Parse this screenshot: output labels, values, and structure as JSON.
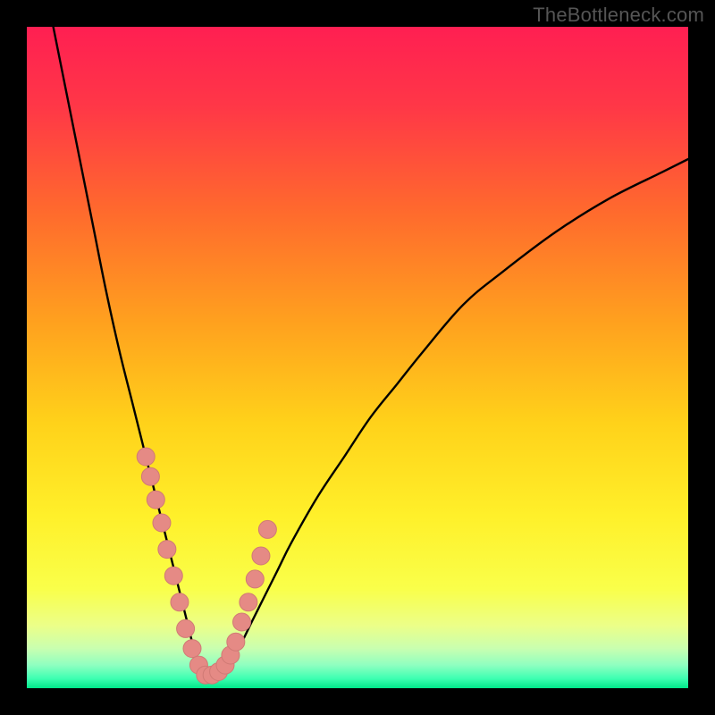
{
  "watermark": "TheBottleneck.com",
  "colors": {
    "frame": "#000000",
    "curve": "#000000",
    "marker_fill": "#e58a85",
    "marker_stroke": "#d07a75",
    "gradient_stops": [
      {
        "offset": 0.0,
        "color": "#ff1f52"
      },
      {
        "offset": 0.12,
        "color": "#ff3747"
      },
      {
        "offset": 0.28,
        "color": "#ff6a2d"
      },
      {
        "offset": 0.45,
        "color": "#ffa21e"
      },
      {
        "offset": 0.6,
        "color": "#ffd21a"
      },
      {
        "offset": 0.74,
        "color": "#fff02a"
      },
      {
        "offset": 0.85,
        "color": "#f9ff4a"
      },
      {
        "offset": 0.905,
        "color": "#ecff88"
      },
      {
        "offset": 0.94,
        "color": "#c9ffb0"
      },
      {
        "offset": 0.965,
        "color": "#8fffc0"
      },
      {
        "offset": 0.985,
        "color": "#3fffb2"
      },
      {
        "offset": 1.0,
        "color": "#00e688"
      }
    ]
  },
  "chart_data": {
    "type": "line",
    "title": "",
    "xlabel": "",
    "ylabel": "",
    "xlim": [
      0,
      100
    ],
    "ylim": [
      0,
      100
    ],
    "grid": false,
    "legend": false,
    "series": [
      {
        "name": "bottleneck-curve",
        "x": [
          4,
          6,
          8,
          10,
          12,
          14,
          16,
          18,
          20,
          22,
          23,
          24,
          25,
          26,
          27,
          28,
          30,
          32,
          34,
          36,
          38,
          40,
          44,
          48,
          52,
          56,
          60,
          66,
          72,
          80,
          88,
          96,
          100
        ],
        "y": [
          100,
          90,
          80,
          70,
          60,
          51,
          43,
          35,
          27,
          19,
          15,
          11,
          7,
          4,
          2,
          2,
          3,
          6,
          10,
          14,
          18,
          22,
          29,
          35,
          41,
          46,
          51,
          58,
          63,
          69,
          74,
          78,
          80
        ]
      }
    ],
    "markers": {
      "name": "highlight-points",
      "x": [
        18.0,
        18.7,
        19.5,
        20.4,
        21.2,
        22.2,
        23.1,
        24.0,
        25.0,
        26.0,
        27.0,
        28.0,
        29.0,
        30.0,
        30.8,
        31.6,
        32.5,
        33.5,
        34.5,
        35.4,
        36.4
      ],
      "y": [
        35.0,
        32.0,
        28.5,
        25.0,
        21.0,
        17.0,
        13.0,
        9.0,
        6.0,
        3.5,
        2.0,
        2.0,
        2.5,
        3.5,
        5.0,
        7.0,
        10.0,
        13.0,
        16.5,
        20.0,
        24.0
      ]
    }
  }
}
